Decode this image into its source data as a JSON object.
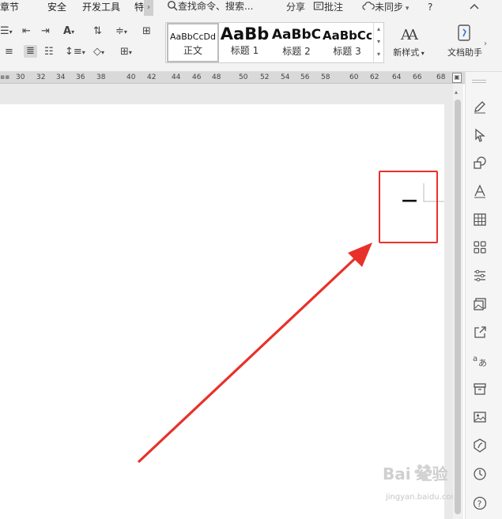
{
  "menu": {
    "items": [
      "章节",
      "安全",
      "开发工具",
      "特"
    ],
    "chevron": "›",
    "search_placeholder": "查找命令、搜索...",
    "share": "分享",
    "comment": "批注",
    "sync": "未同步",
    "help": "?"
  },
  "styles": {
    "items": [
      {
        "sample": "AaBbCcDd",
        "label": "正文"
      },
      {
        "sample": "AaBb",
        "label": "标题 1"
      },
      {
        "sample": "AaBbC",
        "label": "标题 2"
      },
      {
        "sample": "AaBbCc",
        "label": "标题 3"
      }
    ],
    "new_style": "新样式",
    "doc_assistant": "文档助手"
  },
  "ruler": {
    "numbers": [
      "30",
      "32",
      "34",
      "36",
      "38",
      "40",
      "42",
      "44",
      "46",
      "48",
      "50",
      "52",
      "54",
      "56",
      "58",
      "60",
      "62",
      "64",
      "66",
      "68"
    ]
  },
  "document": {
    "cursor_text": "—"
  },
  "annotation": {
    "color": "#e8312a"
  },
  "watermark": {
    "brand": "Bai 经验",
    "url": "jingyan.baidu.com"
  },
  "side_panel": {
    "icons": [
      "pen-icon",
      "select-icon",
      "shapes-icon",
      "text-icon",
      "table-icon",
      "apps-icon",
      "settings-icon",
      "image-gallery-icon",
      "share-icon",
      "translate-icon",
      "archive-icon",
      "picture-icon",
      "shield-icon",
      "history-icon",
      "help-icon"
    ]
  }
}
